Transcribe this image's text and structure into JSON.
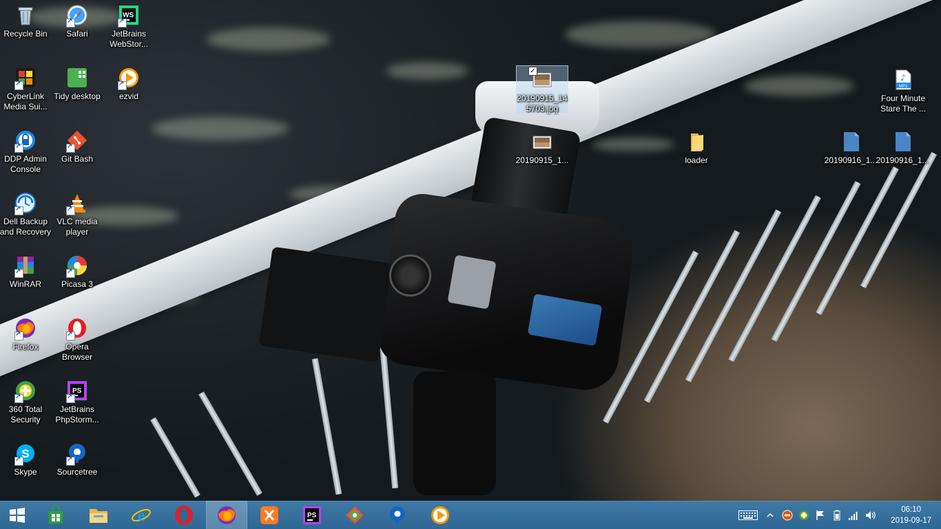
{
  "desktop": {
    "icons": [
      {
        "id": "recycle-bin",
        "label": "Recycle Bin"
      },
      {
        "id": "safari",
        "label": "Safari"
      },
      {
        "id": "jetbrains-webstorm",
        "label": "JetBrains WebStor..."
      },
      {
        "id": "cyberlink",
        "label": "CyberLink Media Sui..."
      },
      {
        "id": "tidy-desktop",
        "label": "Tidy desktop"
      },
      {
        "id": "ezvid",
        "label": "ezvid"
      },
      {
        "id": "ddp-admin",
        "label": "DDP Admin Console"
      },
      {
        "id": "git-bash",
        "label": "Git Bash"
      },
      {
        "id": "dell-backup",
        "label": "Dell Backup and Recovery"
      },
      {
        "id": "vlc",
        "label": "VLC media player"
      },
      {
        "id": "winrar",
        "label": "WinRAR"
      },
      {
        "id": "picasa",
        "label": "Picasa 3"
      },
      {
        "id": "firefox",
        "label": "Firefox"
      },
      {
        "id": "opera",
        "label": "Opera Browser"
      },
      {
        "id": "360-security",
        "label": "360 Total Security"
      },
      {
        "id": "phpstorm",
        "label": "JetBrains PhpStorm..."
      },
      {
        "id": "skype",
        "label": "Skype"
      },
      {
        "id": "sourcetree",
        "label": "Sourcetree"
      },
      {
        "id": "img-selected",
        "label": "20190915_145703.jpg"
      },
      {
        "id": "img-2",
        "label": "20190915_1..."
      },
      {
        "id": "loader",
        "label": "loader"
      },
      {
        "id": "doc-1",
        "label": "20190916_1..."
      },
      {
        "id": "doc-2",
        "label": "20190916_1..."
      },
      {
        "id": "mp3",
        "label": "Four Minute Stare The ..."
      }
    ]
  },
  "taskbar": {
    "start_icon": "windows-logo-icon",
    "pinned": [
      {
        "id": "store",
        "icon": "store-icon"
      },
      {
        "id": "file-explorer",
        "icon": "folder-icon"
      },
      {
        "id": "internet-explorer",
        "icon": "ie-icon"
      },
      {
        "id": "opera",
        "icon": "opera-icon"
      },
      {
        "id": "firefox",
        "icon": "firefox-icon",
        "active": true
      },
      {
        "id": "xampp",
        "icon": "xampp-icon"
      },
      {
        "id": "phpstorm",
        "icon": "phpstorm-icon"
      },
      {
        "id": "gitkraken",
        "icon": "git-icon"
      },
      {
        "id": "sourcetree",
        "icon": "sourcetree-icon"
      },
      {
        "id": "ezvid",
        "icon": "ezvid-icon"
      }
    ],
    "tray_icons": [
      "keyboard-icon",
      "chevron-up-icon",
      "stop-icon",
      "360-icon",
      "flag-icon",
      "battery-icon",
      "signal-icon",
      "volume-icon"
    ],
    "clock": {
      "time": "06:10",
      "date": "2019-09-17"
    }
  },
  "colors": {
    "taskbar": "#3a72a0",
    "selection": "#add2f5"
  }
}
